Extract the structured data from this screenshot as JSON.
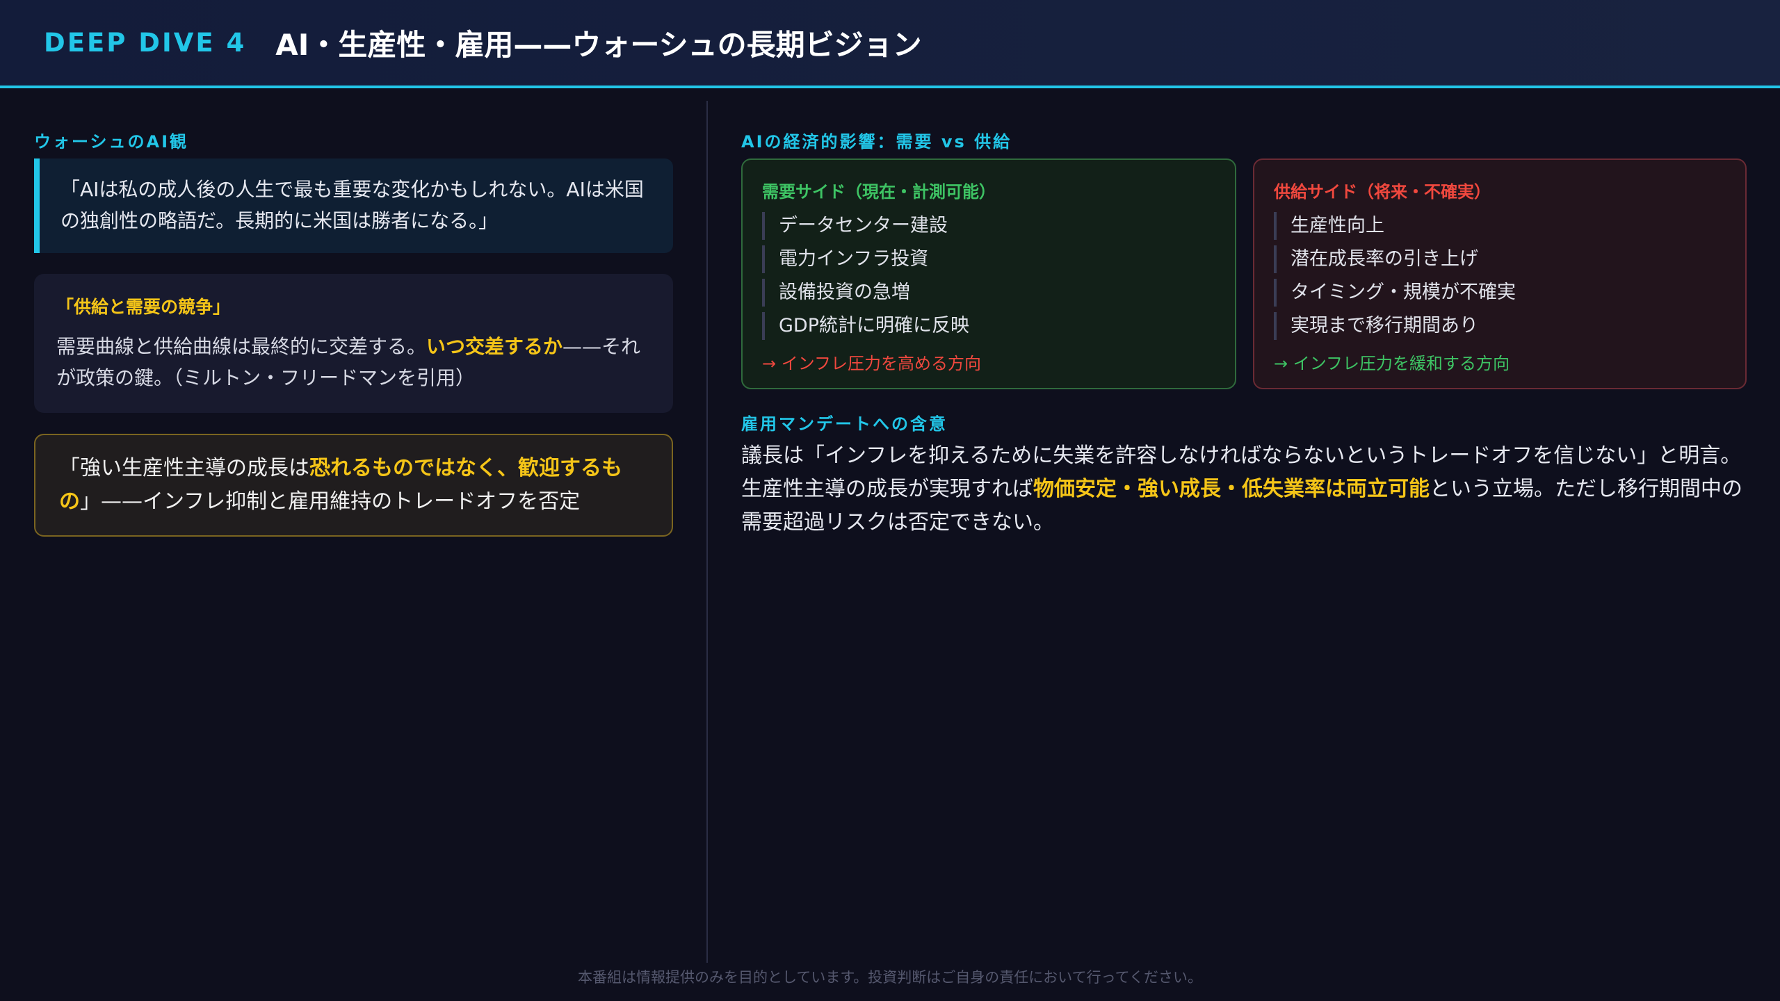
{
  "header": {
    "tag": "DEEP DIVE 4",
    "title": "AI・生産性・雇用——ウォーシュの長期ビジョン"
  },
  "left": {
    "section_title": "ウォーシュのAI観",
    "quote": "「AIは私の成人後の人生で最も重要な変化かもしれない。AIは米国の独創性の略語だ。長期的に米国は勝者になる。」",
    "supply_demand": {
      "title": "「供給と需要の競争」",
      "body_pre": "需要曲線と供給曲線は最終的に交差する。",
      "body_hl": "いつ交差するか",
      "body_post": "——それが政策の鍵。（ミルトン・フリードマンを引用）"
    },
    "growth_quote": {
      "pre": "「強い生産性主導の成長は",
      "hl": "恐れるものではなく、歓迎するもの",
      "post": "」——インフレ抑制と雇用維持のトレードオフを否定"
    }
  },
  "right": {
    "section_title": "AIの経済的影響：需要 vs 供給",
    "demand": {
      "title": "需要サイド（現在・計測可能）",
      "items": [
        "データセンター建設",
        "電力インフラ投資",
        "設備投資の急増",
        "GDP統計に明確に反映"
      ],
      "foot": "→ インフレ圧力を高める方向"
    },
    "supply": {
      "title": "供給サイド（将来・不確実）",
      "items": [
        "生産性向上",
        "潜在成長率の引き上げ",
        "タイミング・規模が不確実",
        "実現まで移行期間あり"
      ],
      "foot": "→ インフレ圧力を緩和する方向"
    },
    "implication": {
      "title": "雇用マンデートへの含意",
      "line1": "議長は「インフレを抑えるために失業を許容しなければならないというトレードオフを信じない」と明言。",
      "pre": "生産性主導の成長が実現すれば",
      "hl": "物価安定・強い成長・低失業率は両立可能",
      "post": "という立場。ただし移行期間中の需要超過リスクは否定できない。"
    }
  },
  "footer": "本番組は情報提供のみを目的としています。投資判断はご自身の責任において行ってください。",
  "colors": {
    "accent": "#22c6e8",
    "highlight": "#f5c518",
    "green": "#3ec464",
    "red": "#f0483e",
    "background": "#0e0f1d"
  }
}
